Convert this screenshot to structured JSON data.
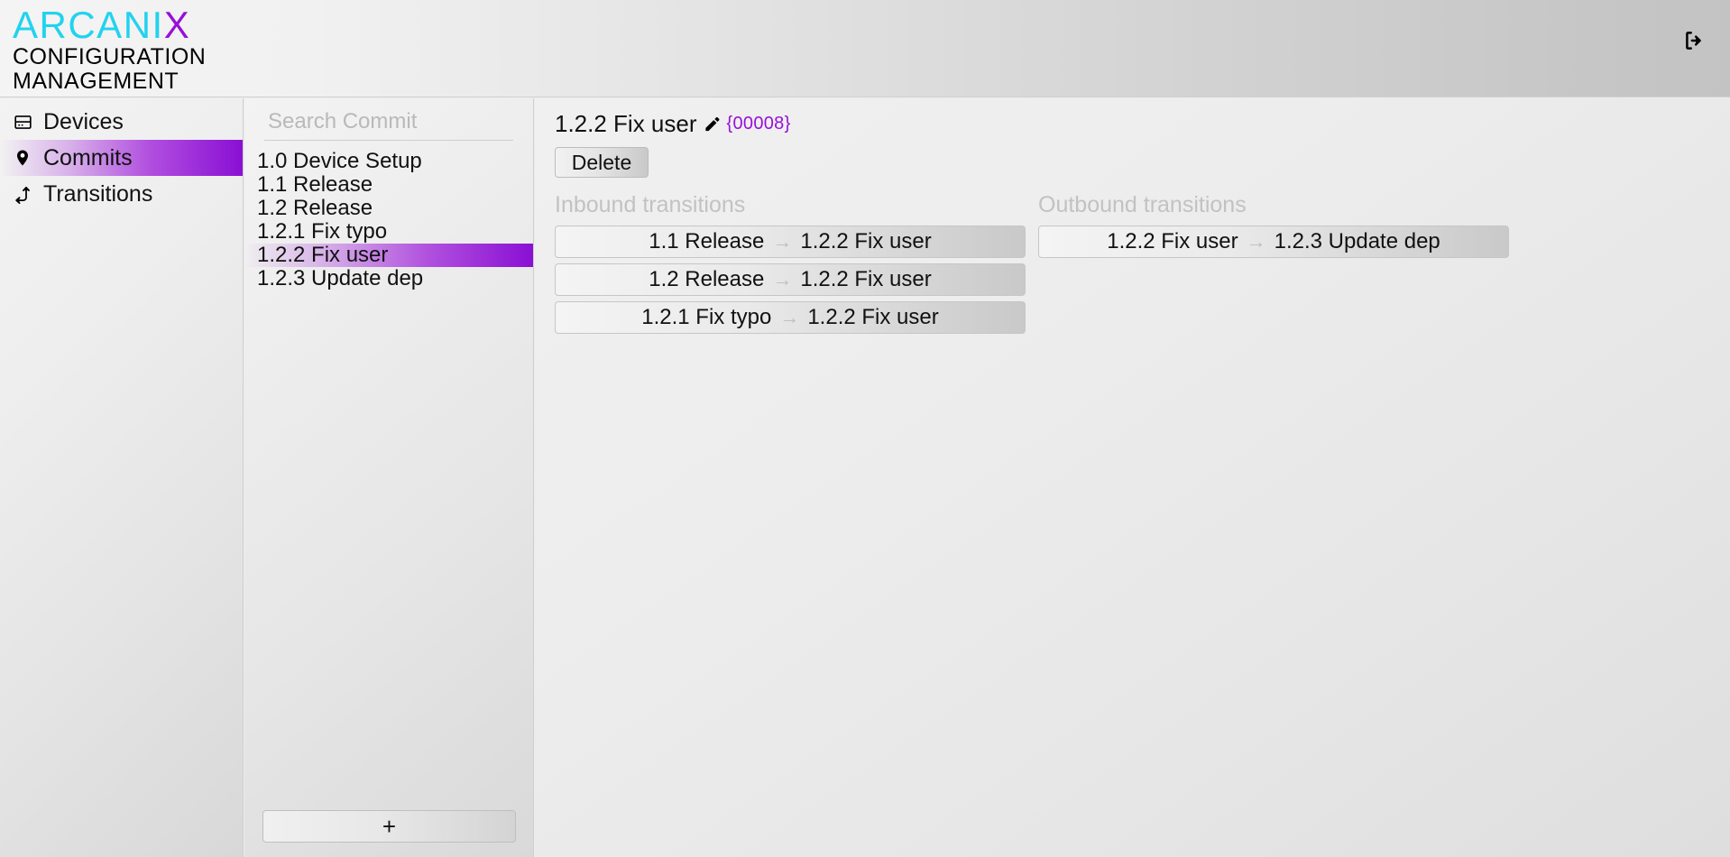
{
  "header": {
    "logo_main": "ARCANI",
    "logo_accent": "X",
    "logo_sub_line1": "CONFIGURATION",
    "logo_sub_line2": "MANAGEMENT",
    "logo_color_cyan": "#22d3ee",
    "logo_color_purple": "#9810d8",
    "logout_label": "logout-icon"
  },
  "sidebar": {
    "items": [
      {
        "label": "Devices",
        "icon": "server-icon",
        "active": false
      },
      {
        "label": "Commits",
        "icon": "map-pin-icon",
        "active": true
      },
      {
        "label": "Transitions",
        "icon": "branch-arrow-icon",
        "active": false
      }
    ],
    "accent_color": "#8a0fd4"
  },
  "commit_panel": {
    "search_placeholder": "Search Commit",
    "search_value": "",
    "add_label": "+",
    "items": [
      {
        "label": "1.0 Device Setup",
        "selected": false
      },
      {
        "label": "1.1 Release",
        "selected": false
      },
      {
        "label": "1.2 Release",
        "selected": false
      },
      {
        "label": "1.2.1 Fix typo",
        "selected": false
      },
      {
        "label": "1.2.2 Fix user",
        "selected": true
      },
      {
        "label": "1.2.3 Update dep",
        "selected": false
      }
    ]
  },
  "detail": {
    "title": "1.2.2 Fix user",
    "id": "{00008}",
    "id_color": "#9810d8",
    "delete_label": "Delete",
    "inbound_title": "Inbound transitions",
    "outbound_title": "Outbound transitions",
    "arrow_glyph": "→",
    "inbound": [
      {
        "from": "1.1 Release",
        "to": "1.2.2 Fix user"
      },
      {
        "from": "1.2 Release",
        "to": "1.2.2 Fix user"
      },
      {
        "from": "1.2.1 Fix typo",
        "to": "1.2.2 Fix user"
      }
    ],
    "outbound": [
      {
        "from": "1.2.2 Fix user",
        "to": "1.2.3 Update dep"
      }
    ]
  }
}
